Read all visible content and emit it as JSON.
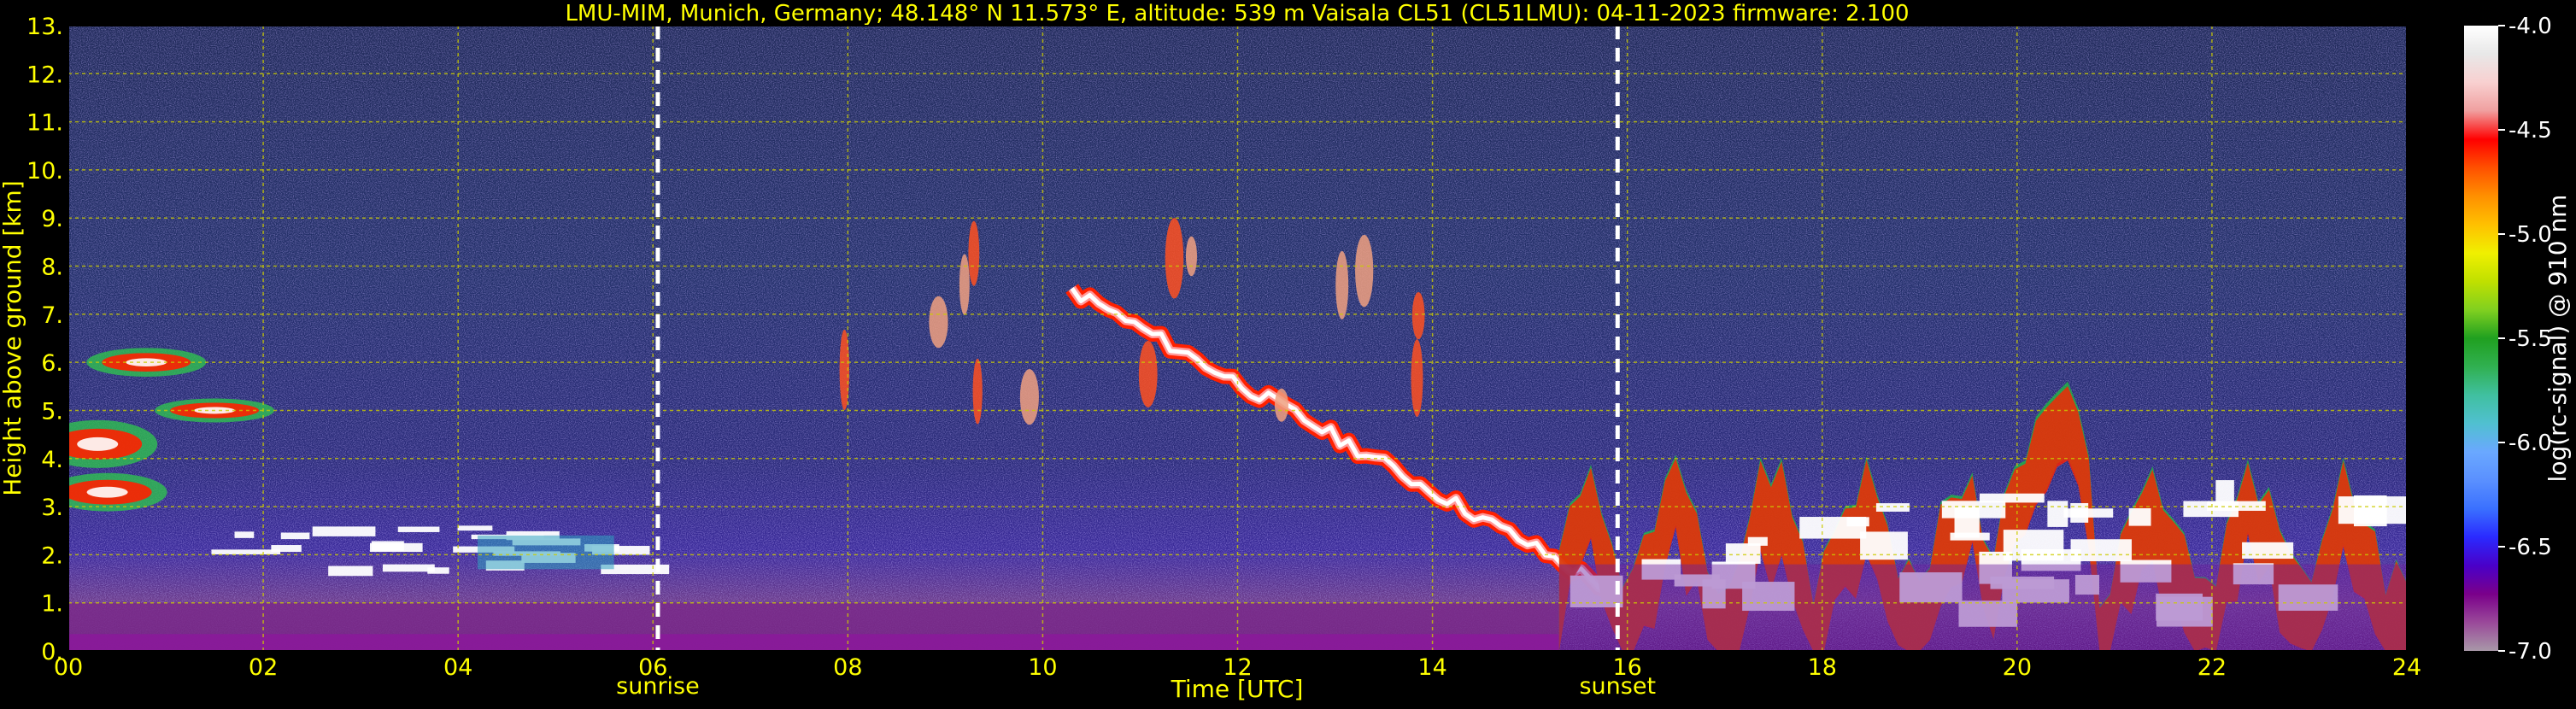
{
  "title": "LMU-MIM, Munich, Germany; 48.148° N 11.573° E, altitude: 539 m    Vaisala CL51 (CL51LMU): 04-11-2023    firmware: 2.100",
  "chart_data": {
    "type": "heatmap",
    "xlabel": "Time [UTC]",
    "ylabel": "Height above ground [km]",
    "xlim": [
      0,
      24
    ],
    "ylim": [
      0,
      13
    ],
    "x_ticks": [
      "00",
      "02",
      "04",
      "06",
      "08",
      "10",
      "12",
      "14",
      "16",
      "18",
      "20",
      "22",
      "24"
    ],
    "y_ticks": [
      "0.",
      "1.",
      "2.",
      "3.",
      "4.",
      "5.",
      "6.",
      "7.",
      "8.",
      "9.",
      "10.",
      "11.",
      "12.",
      "13."
    ],
    "grid": true,
    "markers": [
      {
        "label": "sunrise",
        "time": 6.05
      },
      {
        "label": "sunset",
        "time": 15.9
      }
    ],
    "colorbar": {
      "label": "log(rc-signal) @ 910 nm",
      "range": [
        -7.0,
        -4.0
      ],
      "ticks": [
        "-4.0",
        "-4.5",
        "-5.0",
        "-5.5",
        "-6.0",
        "-6.5",
        "-7.0"
      ],
      "colors": [
        "#a898a8",
        "#9a4a9a",
        "#7a008a",
        "#4a00c8",
        "#2a2aff",
        "#3a70ff",
        "#5a90ff",
        "#6aa8ff",
        "#50c0d0",
        "#40c0a0",
        "#30b050",
        "#20a020",
        "#80d020",
        "#c0e000",
        "#f0f000",
        "#ffc000",
        "#ff9000",
        "#ff5000",
        "#ff0000",
        "#f0a0a0",
        "#f8d0d0",
        "#e8e8e8",
        "#ffffff"
      ]
    },
    "features": [
      {
        "name": "surface aerosol layer",
        "start": 0,
        "end": 15.3,
        "base_km": 0,
        "top_km": 1.0,
        "log_signal": -6.6
      },
      {
        "name": "early morning cloud",
        "start": 0,
        "end": 1.1,
        "base_km": 2.8,
        "top_km": 6.5,
        "log_signal": -5.0
      },
      {
        "name": "low cloud band",
        "start": 1.2,
        "end": 5.5,
        "base_km": 1.7,
        "top_km": 2.7,
        "log_signal": -4.3
      },
      {
        "name": "descending cloud layer",
        "start": 10.3,
        "end": 15.8,
        "base_km": 1.3,
        "top_km": 7.5,
        "log_signal": -4.2
      },
      {
        "name": "cirrus streaks",
        "start": 7.7,
        "end": 14.1,
        "base_km": 5.0,
        "top_km": 8.5,
        "log_signal": -5.1
      },
      {
        "name": "evening boundary layer clouds",
        "start": 15.3,
        "end": 24,
        "base_km": 0,
        "top_km": 5.6,
        "log_signal": -4.2
      }
    ]
  }
}
